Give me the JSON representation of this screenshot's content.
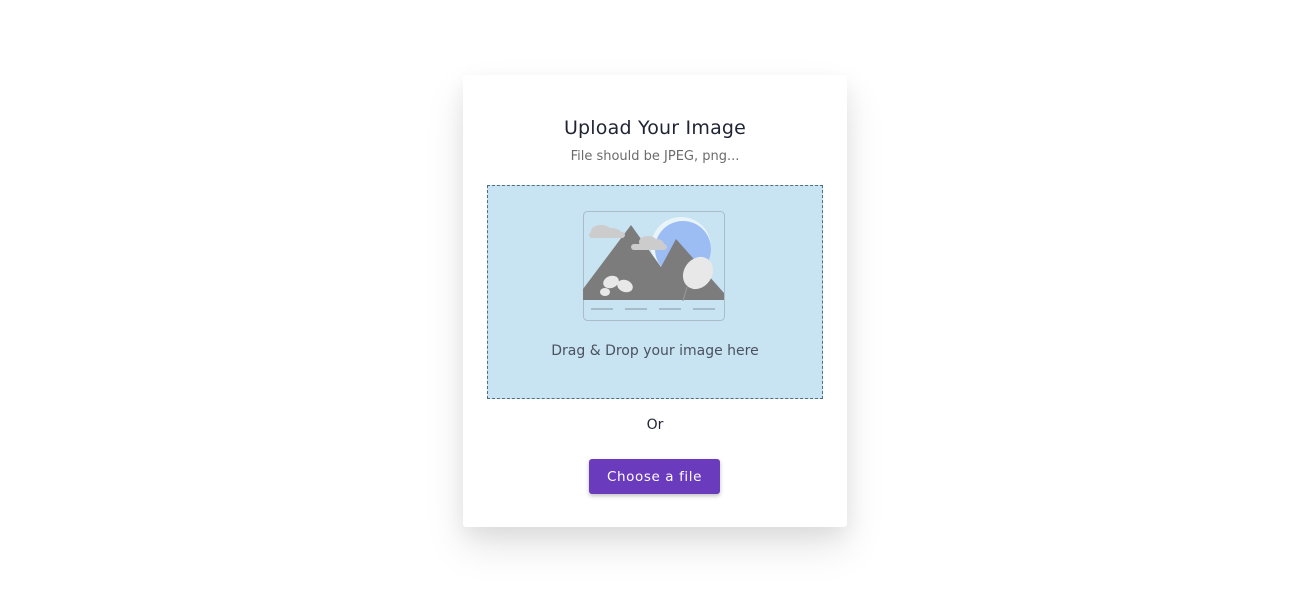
{
  "card": {
    "title": "Upload Your Image",
    "subtitle": "File should be JPEG, png..."
  },
  "dropzone": {
    "text": "Drag & Drop your image here",
    "icon": "image-placeholder-icon"
  },
  "separator": {
    "text": "Or"
  },
  "button": {
    "label": "Choose a file"
  },
  "colors": {
    "dropzone_bg": "#c8e3f1",
    "button_bg": "#6a3bbd",
    "title": "#1f2433"
  }
}
